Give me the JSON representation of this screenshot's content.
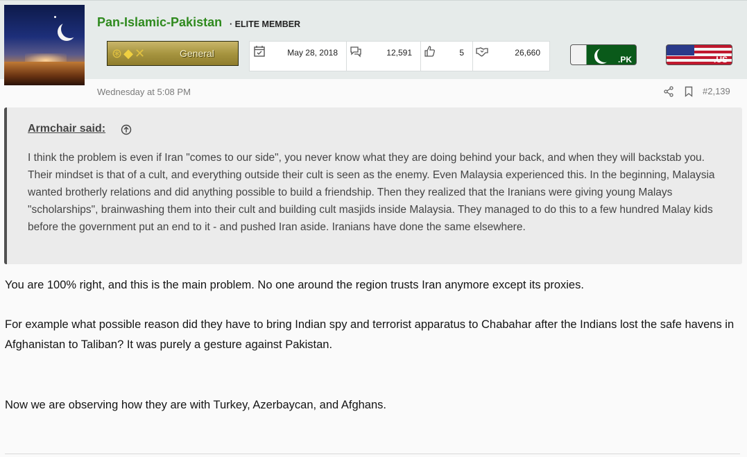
{
  "post": {
    "username": "Pan-Islamic-Pakistan",
    "member_title": "· ELITE MEMBER",
    "rank_label": "General",
    "stats": {
      "joined": "May 28, 2018",
      "messages": "12,591",
      "reaction_score": "5",
      "points": "26,660"
    },
    "flags": {
      "country": ".PK",
      "location": ".US"
    },
    "timestamp": "Wednesday at 5:08 PM",
    "post_number": "#2,139"
  },
  "quote": {
    "author": "Armchair said:",
    "text": "I think the problem is even if Iran \"comes to our side\", you never know what they are doing behind your back, and when they will backstab you. Their mindset is that of a cult, and everything outside their cult is seen as the enemy. Even Malaysia experienced this. In the beginning, Malaysia wanted brotherly relations and did anything possible to build a friendship. Then they realized that the Iranians were giving young Malays \"scholarships\", brainwashing them into their cult and building cult masjids inside Malaysia. They managed to do this to a few hundred Malay kids before the government put an end to it - and pushed Iran aside. Iranians have done the same elsewhere."
  },
  "reply": {
    "p1": "You are 100% right, and this is the main problem. No one around the region trusts Iran anymore except its proxies.",
    "p2": "For example what possible reason did they have to bring Indian spy and terrorist apparatus to Chabahar after the Indians lost the safe havens in Afghanistan to Taliban? It was purely a gesture against Pakistan.",
    "p3": "Now we are observing how they are with Turkey, Azerbaycan, and Afghans."
  },
  "colors": {
    "username": "#2f8a1e",
    "header_band": "#e6ebea",
    "quote_bg": "#ebebeb"
  }
}
